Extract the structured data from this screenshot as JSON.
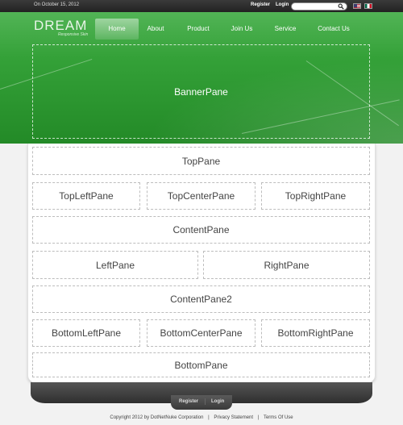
{
  "topbar": {
    "date": "On October 15, 2012",
    "register_label": "Register",
    "login_label": "Login",
    "search_placeholder": ""
  },
  "header": {
    "logo_title": "DREAM",
    "logo_subtitle": "Responsive Skin",
    "nav": [
      "Home",
      "About",
      "Product",
      "Join Us",
      "Service",
      "Contact Us"
    ],
    "active_nav": "Home"
  },
  "panes": {
    "banner": "BannerPane",
    "top": "TopPane",
    "top_left": "TopLeftPane",
    "top_center": "TopCenterPane",
    "top_right": "TopRightPane",
    "content": "ContentPane",
    "left": "LeftPane",
    "right": "RightPane",
    "content2": "ContentPane2",
    "bottom_left": "BottomLeftPane",
    "bottom_center": "BottomCenterPane",
    "bottom_right": "BottomRightPane",
    "bottom": "BottomPane"
  },
  "footer": {
    "register_label": "Register",
    "login_label": "Login",
    "copyright": "Copyright 2012 by DotNetNuke Corporation",
    "separator": "|",
    "privacy": "Privacy Statement",
    "terms": "Terms Of Use"
  },
  "colors": {
    "brand_green": "#34a138",
    "topbar": "#2a2a2a"
  },
  "icons": {
    "search": "search-icon",
    "flag_en": "us-flag-icon",
    "flag_es": "mexico-flag-icon"
  }
}
